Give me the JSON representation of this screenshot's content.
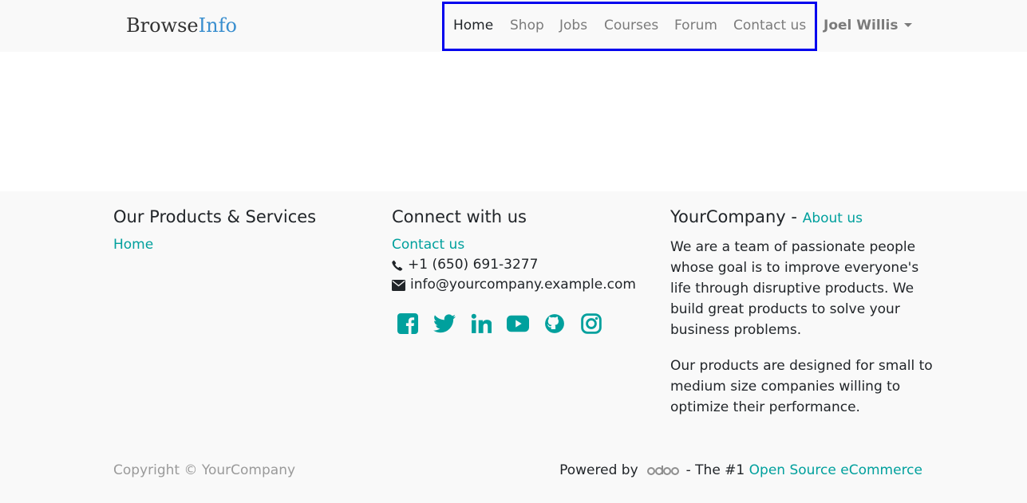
{
  "brand": {
    "part1": "Browse",
    "part2": "Info"
  },
  "nav": {
    "items": [
      {
        "label": "Home",
        "active": true
      },
      {
        "label": "Shop"
      },
      {
        "label": "Jobs"
      },
      {
        "label": "Courses"
      },
      {
        "label": "Forum"
      },
      {
        "label": "Contact us"
      }
    ],
    "highlight_color": "#0000ee"
  },
  "user": {
    "name": "Joel Willis"
  },
  "footer": {
    "products": {
      "title": "Our Products & Services",
      "link": "Home"
    },
    "connect": {
      "title": "Connect with us",
      "contact_link": "Contact us",
      "phone": "+1 (650) 691-3277",
      "email": "info@yourcompany.example.com",
      "socials": [
        "facebook-icon",
        "twitter-icon",
        "linkedin-icon",
        "youtube-icon",
        "github-icon",
        "instagram-icon"
      ]
    },
    "about": {
      "company": "YourCompany",
      "separator": "-",
      "link": "About us",
      "p1": "We are a team of passionate people whose goal is to improve everyone's life through disruptive products. We build great products to solve your business problems.",
      "p2": "Our products are designed for small to medium size companies willing to optimize their performance."
    },
    "copyright": "Copyright © YourCompany",
    "powered_by": "Powered by",
    "powered_suffix": "- The #1",
    "powered_link": "Open Source eCommerce"
  },
  "colors": {
    "accent": "#00a09d",
    "brand_blue": "#3a8fcf",
    "muted": "#7b7b7b"
  }
}
